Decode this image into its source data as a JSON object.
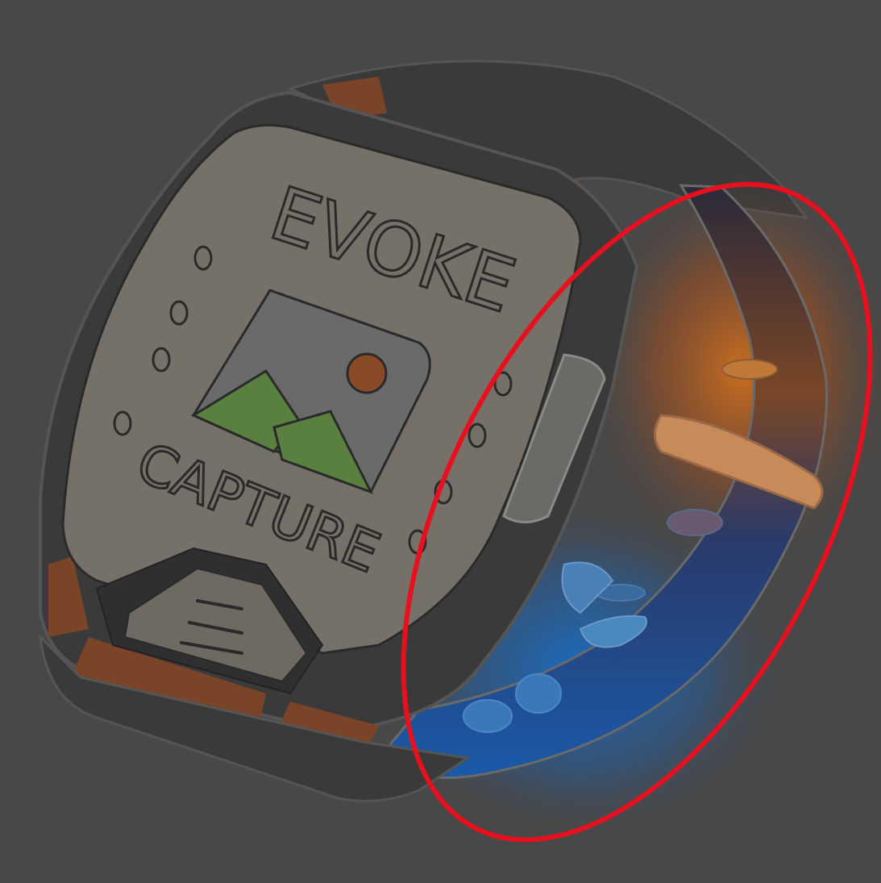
{
  "illustration": {
    "screen_logo_top": "EVOKE",
    "screen_logo_bottom": "CAPTURE",
    "colors": {
      "background": "#484848",
      "strap_dark": "#3a3a3a",
      "accent_orange": "#8a4a28",
      "screen": "#757068",
      "highlight_red": "#e8101e",
      "glow_orange": "#c86a1e",
      "glow_blue": "#1e6ab4",
      "mountain_green": "#5a8040",
      "sun": "#8a4a28"
    },
    "icons": [
      "image-icon",
      "menu-lines-icon"
    ]
  }
}
